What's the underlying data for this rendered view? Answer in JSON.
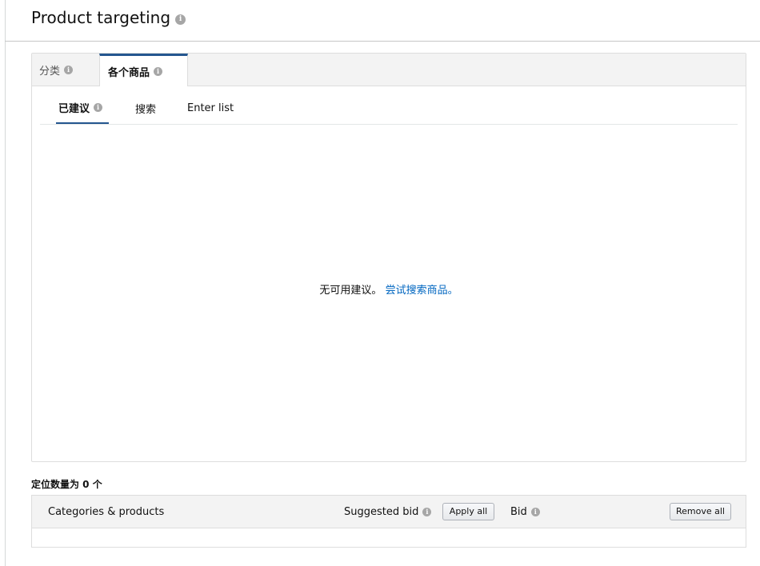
{
  "header": {
    "title": "Product targeting",
    "info_icon": "i"
  },
  "tabs": {
    "category_label": "分类",
    "products_label": "各个商品",
    "active": "products"
  },
  "subtabs": {
    "suggested_label": "已建议",
    "search_label": "搜索",
    "enter_list_label": "Enter list",
    "active": "suggested"
  },
  "empty_state": {
    "message": "无可用建议。",
    "link": "尝试搜索商品。"
  },
  "targets": {
    "count_label": "定位数量为 0 个"
  },
  "table": {
    "col_categories": "Categories & products",
    "col_suggested_bid": "Suggested bid",
    "apply_all_label": "Apply all",
    "col_bid": "Bid",
    "remove_all_label": "Remove all"
  },
  "colors": {
    "accent": "#24568f",
    "link": "#0066c0",
    "header_bg": "#f3f3f3"
  }
}
